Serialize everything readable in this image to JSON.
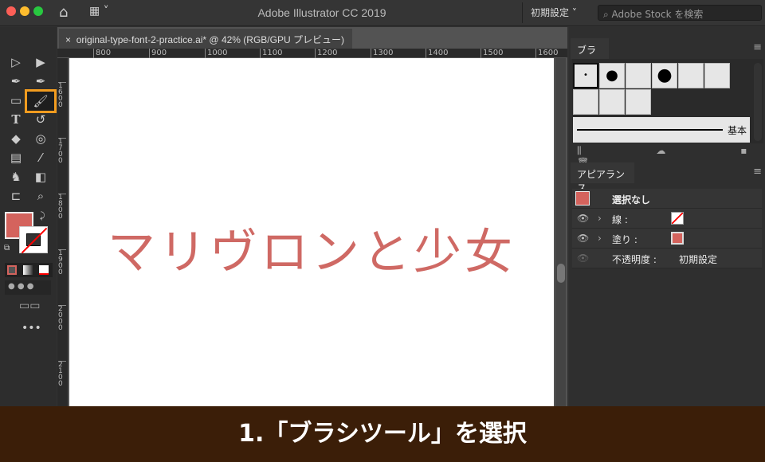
{
  "window": {
    "title": "Adobe Illustrator CC 2019",
    "workspace": "初期設定",
    "stock_placeholder": "Adobe Stock を検索"
  },
  "document": {
    "tab": "original-type-font-2-practice.ai* @ 42% (RGB/GPU プレビュー)",
    "close": "×",
    "artwork_text": "マリヴロンと少女"
  },
  "rulers": {
    "horizontal": [
      "800",
      "900",
      "1000",
      "1100",
      "1200",
      "1300",
      "1400",
      "1500",
      "1600"
    ],
    "vertical": [
      "1600",
      "1700",
      "1800",
      "1900",
      "2000",
      "2100"
    ]
  },
  "brush_panel": {
    "title": "ブラシ",
    "basic_label": "基本"
  },
  "appearance_panel": {
    "title": "アピアランス",
    "no_selection": "選択なし",
    "stroke": "線 :",
    "fill": "塗り :",
    "opacity": "不透明度 :",
    "opacity_value": "初期設定"
  },
  "caption": "1.「ブラシツール」を選択",
  "colors": {
    "fill": "#d4635d",
    "highlight": "#f29c1f",
    "caption_bg": "#3b1e08"
  }
}
